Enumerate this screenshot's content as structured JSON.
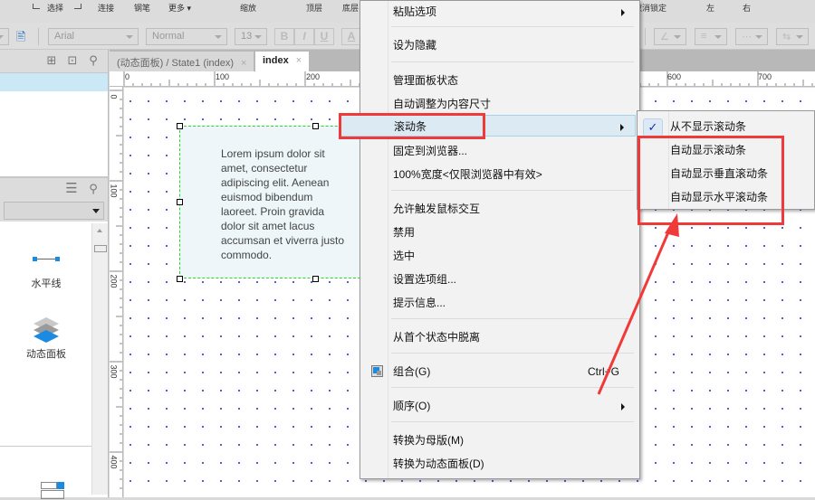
{
  "toolbar_row1": {
    "items": [
      "选择",
      "连接",
      "钢笔",
      "更多 ▾",
      "缩放",
      "顶层",
      "底层",
      "取消锁定",
      "左",
      "右"
    ]
  },
  "toolbar_row2": {
    "font_family": "Arial",
    "font_style": "Normal",
    "font_size": "13",
    "bold": "B",
    "italic": "I",
    "underline": "U",
    "font_color": "A"
  },
  "left_panel": {
    "widgets": [
      "水平线",
      "动态面板"
    ]
  },
  "tabs": [
    {
      "label": "(动态面板) / State1 (index)",
      "close": "×",
      "active": false
    },
    {
      "label": "index",
      "close": "×",
      "active": true
    }
  ],
  "ruler": {
    "horizontal": [
      "0",
      "100",
      "200",
      "600",
      "700"
    ],
    "vertical": [
      "0",
      "100",
      "200",
      "300",
      "400"
    ]
  },
  "canvas": {
    "panel_text": "Lorem ipsum dolor sit amet, consectetur adipiscing elit. Aenean euismod bibendum laoreet. Proin gravida dolor sit amet lacus accumsan et viverra justo commodo."
  },
  "context_menu": {
    "items": [
      {
        "label": "粘贴选项",
        "submenu": true
      },
      {
        "label": "设为隐藏"
      },
      {
        "label": "管理面板状态"
      },
      {
        "label": "自动调整为内容尺寸"
      },
      {
        "label": "滚动条",
        "submenu": true,
        "highlighted": true
      },
      {
        "label": "固定到浏览器..."
      },
      {
        "label": "100%宽度<仅限浏览器中有效>"
      },
      {
        "label": "允许触发鼠标交互"
      },
      {
        "label": "禁用"
      },
      {
        "label": "选中"
      },
      {
        "label": "设置选项组..."
      },
      {
        "label": "提示信息..."
      },
      {
        "label": "从首个状态中脱离"
      },
      {
        "label": "组合(G)",
        "shortcut": "Ctrl+G",
        "icon": "group-icon"
      },
      {
        "label": "顺序(O)",
        "submenu": true
      },
      {
        "label": "转换为母版(M)"
      },
      {
        "label": "转换为动态面板(D)"
      }
    ]
  },
  "scrollbar_submenu": {
    "items": [
      {
        "label": "从不显示滚动条",
        "checked": true
      },
      {
        "label": "自动显示滚动条",
        "checked": false
      },
      {
        "label": "自动显示垂直滚动条",
        "checked": false
      },
      {
        "label": "自动显示水平滚动条",
        "checked": false
      }
    ],
    "check_glyph": "✓"
  },
  "colors": {
    "annotation_red": "#f03a3a",
    "selection_green": "#22dd22",
    "menu_highlight": "#dceaf4",
    "accent_blue": "#1a8be0"
  }
}
